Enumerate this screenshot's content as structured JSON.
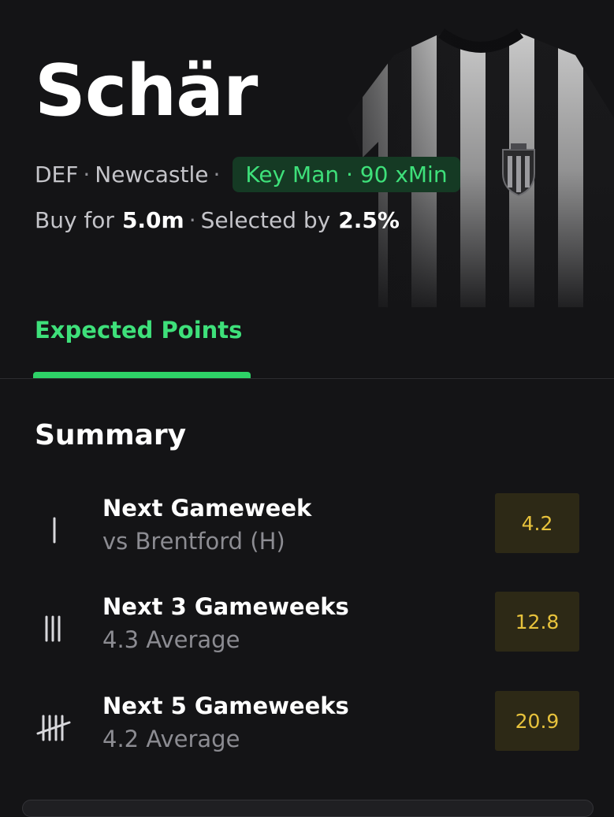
{
  "player": {
    "name": "Schär",
    "position": "DEF",
    "team": "Newcastle",
    "badge": "Key Man · 90 xMin",
    "buy_label": "Buy for",
    "price": "5.0m",
    "selected_label": "Selected by",
    "selected_pct": "2.5%"
  },
  "tabs": [
    {
      "label": "Expected Points",
      "active": true
    }
  ],
  "summary": {
    "title": "Summary",
    "rows": [
      {
        "icon": "tally-one-icon",
        "title": "Next Gameweek",
        "subtitle": "vs Brentford (H)",
        "value": "4.2"
      },
      {
        "icon": "tally-three-icon",
        "title": "Next 3 Gameweeks",
        "subtitle": "4.3 Average",
        "value": "12.8"
      },
      {
        "icon": "tally-five-icon",
        "title": "Next 5 Gameweeks",
        "subtitle": "4.2 Average",
        "value": "20.9"
      }
    ]
  },
  "colors": {
    "background": "#141416",
    "accent_green": "#3ee07a",
    "badge_background": "#153a24",
    "value_text": "#e7c23c",
    "value_background": "#2d2916"
  }
}
